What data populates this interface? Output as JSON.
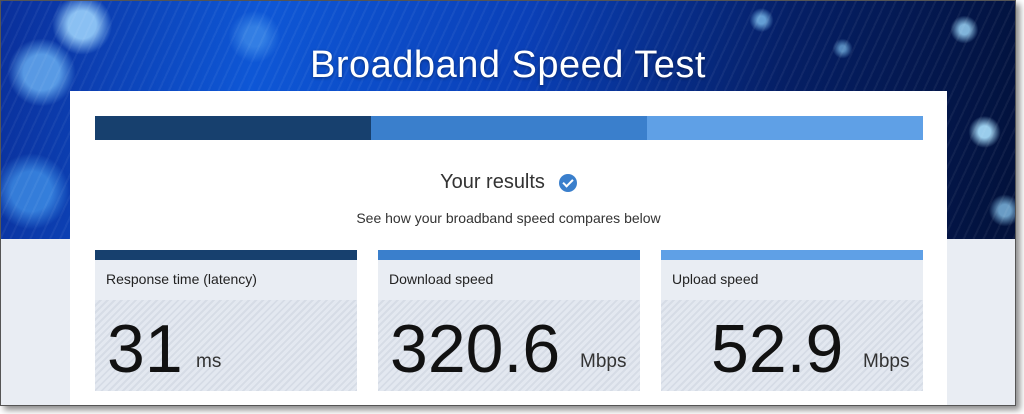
{
  "header": {
    "title": "Broadband Speed Test"
  },
  "progress": {
    "segments": 3,
    "colors": [
      "#17406e",
      "#3a7fcc",
      "#5fa0e6"
    ]
  },
  "results": {
    "heading": "Your results",
    "heading_icon": "check-circle-icon",
    "subtext": "See how your broadband speed compares below"
  },
  "metrics": [
    {
      "label": "Response time (latency)",
      "value": "31",
      "unit": "ms",
      "color": "#17406e"
    },
    {
      "label": "Download speed",
      "value": "320.6",
      "unit": "Mbps",
      "color": "#3a7fcc"
    },
    {
      "label": "Upload speed",
      "value": "52.9",
      "unit": "Mbps",
      "color": "#5fa0e6"
    }
  ]
}
